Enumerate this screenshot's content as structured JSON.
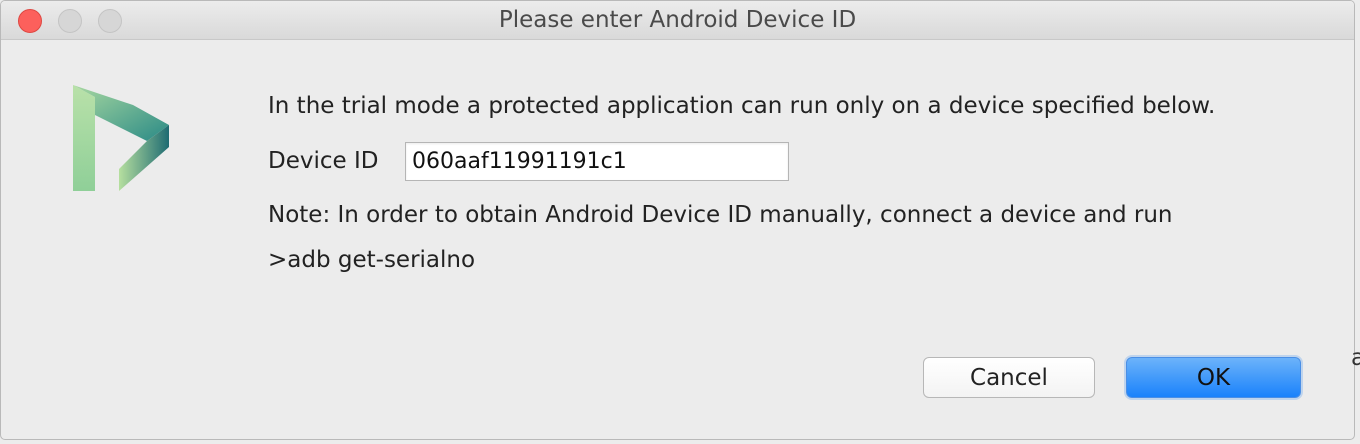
{
  "window": {
    "title": "Please enter Android Device ID"
  },
  "dialog": {
    "intro": "In the trial mode a protected application can run only on a device specified below.",
    "device_id_label": "Device ID",
    "device_id_value": "060aaf11991191c1",
    "note": "Note: In order to obtain Android Device ID manually, connect a device and run",
    "command": ">adb get-serialno"
  },
  "buttons": {
    "cancel": "Cancel",
    "ok": "OK"
  },
  "background": {
    "edge_text": "a"
  },
  "icons": {
    "logo": "play-logo-icon"
  },
  "colors": {
    "accent": "#1a82fb",
    "close": "#fc605c",
    "logo_light": "#a8d8a0",
    "logo_dark": "#1e6b72"
  }
}
